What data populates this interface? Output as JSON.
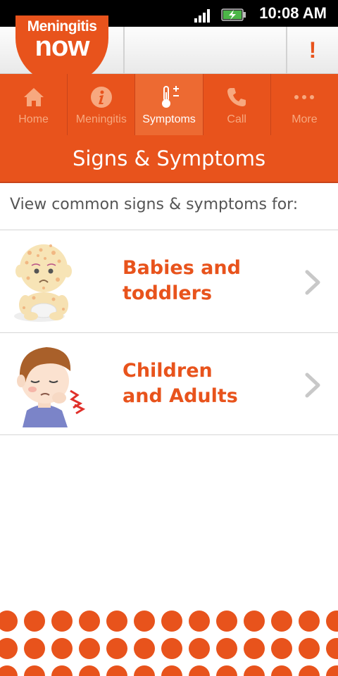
{
  "status_bar": {
    "time": "10:08 AM"
  },
  "header": {
    "logo_top": "Meningitis",
    "logo_bottom": "now",
    "alert_label": "!"
  },
  "tabs": [
    {
      "label": "Home",
      "icon": "home-icon",
      "active": false
    },
    {
      "label": "Meningitis",
      "icon": "info-icon",
      "active": false
    },
    {
      "label": "Symptoms",
      "icon": "thermometer-icon",
      "active": true
    },
    {
      "label": "Call",
      "icon": "phone-icon",
      "active": false
    },
    {
      "label": "More",
      "icon": "more-icon",
      "active": false
    }
  ],
  "page_title": "Signs & Symptoms",
  "intro": "View common signs & symptoms for:",
  "options": [
    {
      "line1": "Babies and",
      "line2": "toddlers",
      "image": "baby-illustration"
    },
    {
      "line1": "Children",
      "line2": "and Adults",
      "image": "child-illustration"
    }
  ],
  "colors": {
    "brand_orange": "#e8531c",
    "active_tab": "#ed6a32",
    "inactive_tab_text": "#f7a87f",
    "chevron": "#c8c8c8"
  }
}
